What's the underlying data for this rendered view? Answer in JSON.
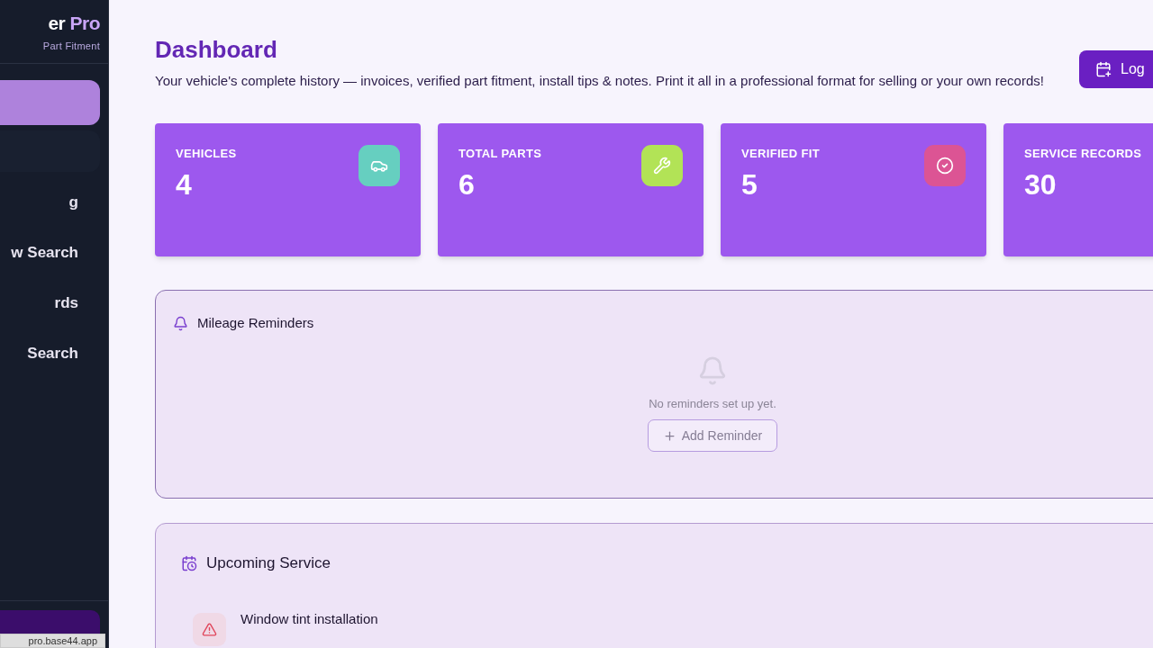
{
  "sidebar": {
    "brand": "er",
    "brand_accent": "Pro",
    "tagline": "Part Fitment",
    "items": [
      {
        "selected": true
      },
      {
        "selected": false
      },
      {
        "label": "g",
        "selected": false
      },
      {
        "label": "w Search",
        "selected": false
      },
      {
        "label": "rds",
        "selected": false
      },
      {
        "label": "Search",
        "selected": false
      }
    ]
  },
  "link_preview": "pro.base44.app",
  "header": {
    "title": "Dashboard",
    "description": "Your vehicle's complete history — invoices, verified part fitment, install tips & notes. Print it all in a professional format for selling or your own records!",
    "action": "Log"
  },
  "stats": [
    {
      "label": "VEHICLES",
      "value": "4",
      "kind": "car",
      "color": "#66cfc0"
    },
    {
      "label": "TOTAL PARTS",
      "value": "6",
      "kind": "wrench",
      "color": "#b2e356"
    },
    {
      "label": "VERIFIED FIT",
      "value": "5",
      "kind": "check",
      "color": "#dc5494"
    },
    {
      "label": "SERVICE RECORDS",
      "value": "30",
      "kind": "none"
    }
  ],
  "reminders": {
    "title": "Mileage Reminders",
    "empty": "No reminders set up yet.",
    "button": "Add Reminder"
  },
  "upcoming": {
    "title": "Upcoming Service",
    "items": [
      {
        "name": "Window tint installation"
      }
    ]
  }
}
